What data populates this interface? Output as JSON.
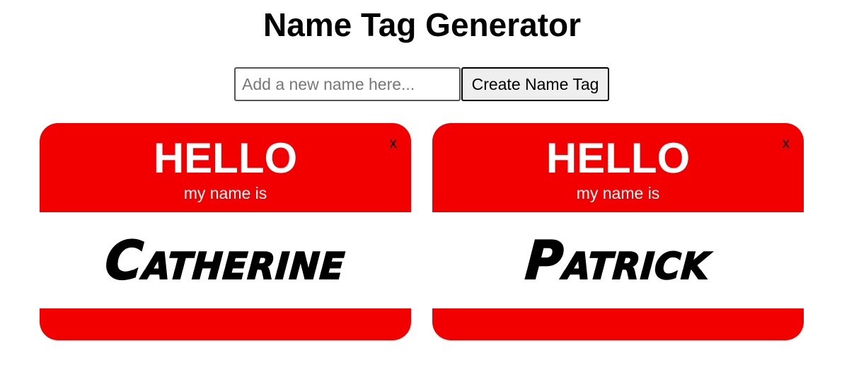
{
  "page": {
    "title": "Name Tag Generator"
  },
  "form": {
    "input_value": "",
    "input_placeholder": "Add a new name here...",
    "create_label": "Create Name Tag"
  },
  "tags": [
    {
      "hello": "HELLO",
      "subtitle": "my name is",
      "name": "Catherine",
      "close_label": "x"
    },
    {
      "hello": "HELLO",
      "subtitle": "my name is",
      "name": "Patrick",
      "close_label": "x"
    }
  ],
  "colors": {
    "tag_red": "#f20000",
    "tag_text": "#ffffff",
    "name_text": "#000000"
  }
}
